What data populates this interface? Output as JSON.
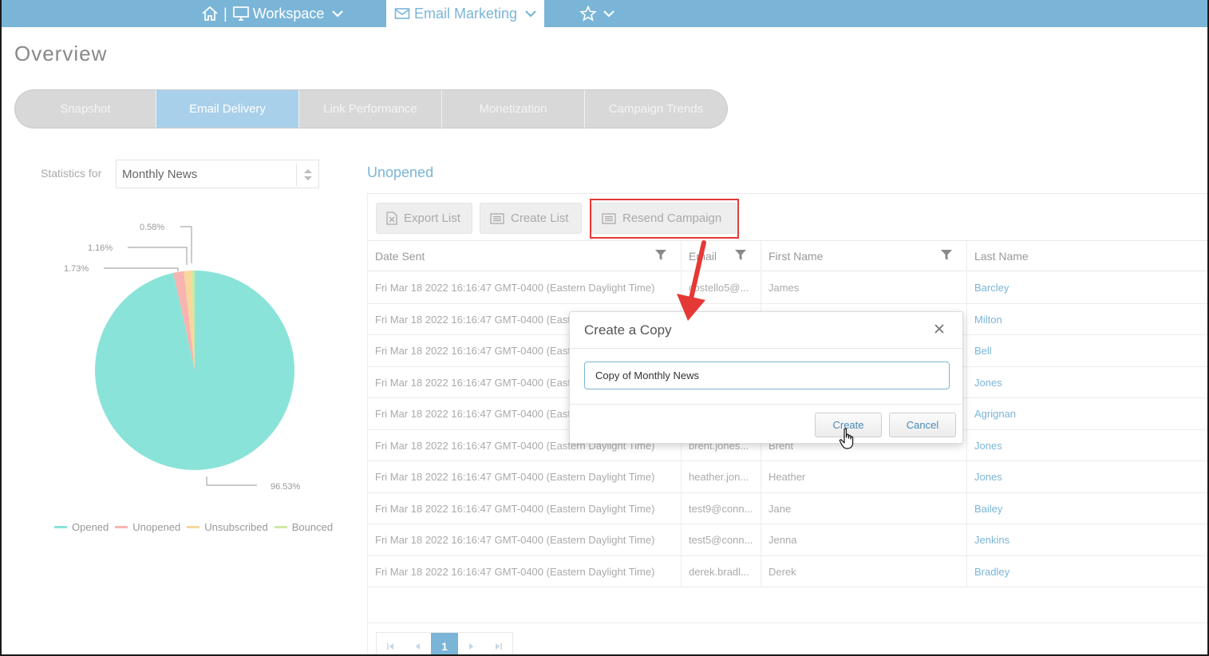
{
  "nav": {
    "workspace_label": "Workspace",
    "separator": "|",
    "email_marketing_label": "Email Marketing",
    "icons": [
      "home-icon",
      "monitor-icon",
      "envelope-icon",
      "star-icon",
      "chevron-down-icon"
    ]
  },
  "page": {
    "title": "Overview"
  },
  "tabs": [
    {
      "label": "Snapshot",
      "active": false
    },
    {
      "label": "Email Delivery",
      "active": true
    },
    {
      "label": "Link Performance",
      "active": false
    },
    {
      "label": "Monetization",
      "active": false
    },
    {
      "label": "Campaign Trends",
      "active": false
    }
  ],
  "stats": {
    "label": "Statistics for",
    "selected_campaign": "Monthly News"
  },
  "chart_data": {
    "type": "pie",
    "slices": [
      {
        "name": "Opened",
        "value": 96.53,
        "label": "96.53%",
        "color": "#8ae3d8"
      },
      {
        "name": "Unopened",
        "value": 1.73,
        "label": "1.73%",
        "color": "#f6b5b0"
      },
      {
        "name": "Unsubscribed",
        "value": 1.16,
        "label": "1.16%",
        "color": "#f7d79b"
      },
      {
        "name": "Bounced",
        "value": 0.58,
        "label": "0.58%",
        "color": "#cfe8a6"
      }
    ],
    "legend_placement": "bottom"
  },
  "grid": {
    "title": "Unopened",
    "toolbar": {
      "export_label": "Export List",
      "create_label": "Create List",
      "resend_label": "Resend Campaign"
    },
    "columns": [
      "Date Sent",
      "Email",
      "First Name",
      "Last Name"
    ],
    "rows": [
      {
        "date": "Fri Mar 18 2022 16:16:47 GMT-0400 (Eastern Daylight Time)",
        "email": "costello5@...",
        "first": "James",
        "last": "Barcley"
      },
      {
        "date": "Fri Mar 18 2022 16:16:47 GMT-0400 (Eastern Daylight Time)",
        "email": "",
        "first": "",
        "last": "Milton"
      },
      {
        "date": "Fri Mar 18 2022 16:16:47 GMT-0400 (Eastern Daylight Time)",
        "email": "",
        "first": "",
        "last": "Bell"
      },
      {
        "date": "Fri Mar 18 2022 16:16:47 GMT-0400 (Eastern Daylight Time)",
        "email": "",
        "first": "",
        "last": "Jones"
      },
      {
        "date": "Fri Mar 18 2022 16:16:47 GMT-0400 (Eastern Daylight Time)",
        "email": "",
        "first": "",
        "last": "Agrignan"
      },
      {
        "date": "Fri Mar 18 2022 16:16:47 GMT-0400 (Eastern Daylight Time)",
        "email": "brent.jones...",
        "first": "Brent",
        "last": "Jones"
      },
      {
        "date": "Fri Mar 18 2022 16:16:47 GMT-0400 (Eastern Daylight Time)",
        "email": "heather.jon...",
        "first": "Heather",
        "last": "Jones"
      },
      {
        "date": "Fri Mar 18 2022 16:16:47 GMT-0400 (Eastern Daylight Time)",
        "email": "test9@conn...",
        "first": "Jane",
        "last": "Bailey"
      },
      {
        "date": "Fri Mar 18 2022 16:16:47 GMT-0400 (Eastern Daylight Time)",
        "email": "test5@conn...",
        "first": "Jenna",
        "last": "Jenkins"
      },
      {
        "date": "Fri Mar 18 2022 16:16:47 GMT-0400 (Eastern Daylight Time)",
        "email": "derek.bradl...",
        "first": "Derek",
        "last": "Bradley"
      }
    ],
    "pager": {
      "current_page": "1"
    }
  },
  "dialog": {
    "title": "Create a Copy",
    "input_value": "Copy of Monthly News",
    "create_label": "Create",
    "cancel_label": "Cancel"
  },
  "colors": {
    "accent": "#7ab5d8",
    "highlight_box": "#e53935",
    "annotation_arrow": "#e53935"
  }
}
